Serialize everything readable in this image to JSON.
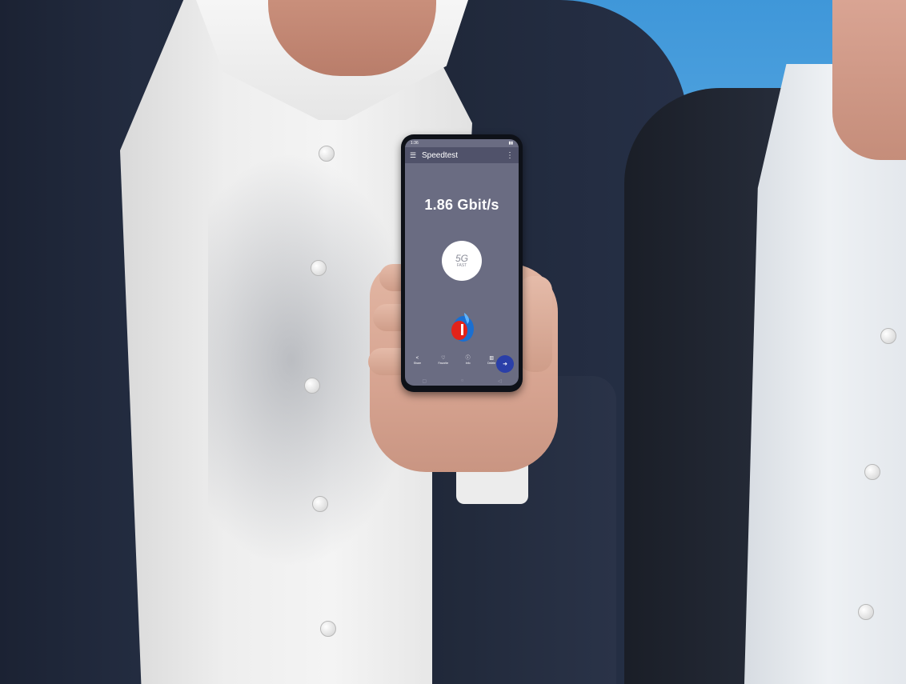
{
  "phone": {
    "status_time": "1:36",
    "app_title": "Speedtest",
    "result_speed": "1.86 Gbit/s",
    "badge_network": "5G",
    "badge_label": "FAST",
    "nav": {
      "share_label": "Share",
      "favorite_label": "Favorite",
      "info_label": "Info",
      "delete_label": "Delete"
    },
    "colors": {
      "screen_bg": "#6a6c82",
      "fab": "#2a3fa8",
      "logo_red": "#e2231a",
      "logo_blue": "#1a6fd1"
    }
  },
  "icons": {
    "menu": "menu-icon",
    "more": "more-vertical-icon",
    "share": "share-icon",
    "favorite": "heart-icon",
    "info": "info-icon",
    "delete": "trash-icon",
    "fab": "speedtest-fab-icon",
    "sys_back": "back-icon",
    "sys_home": "home-icon",
    "sys_recent": "recent-apps-icon"
  }
}
